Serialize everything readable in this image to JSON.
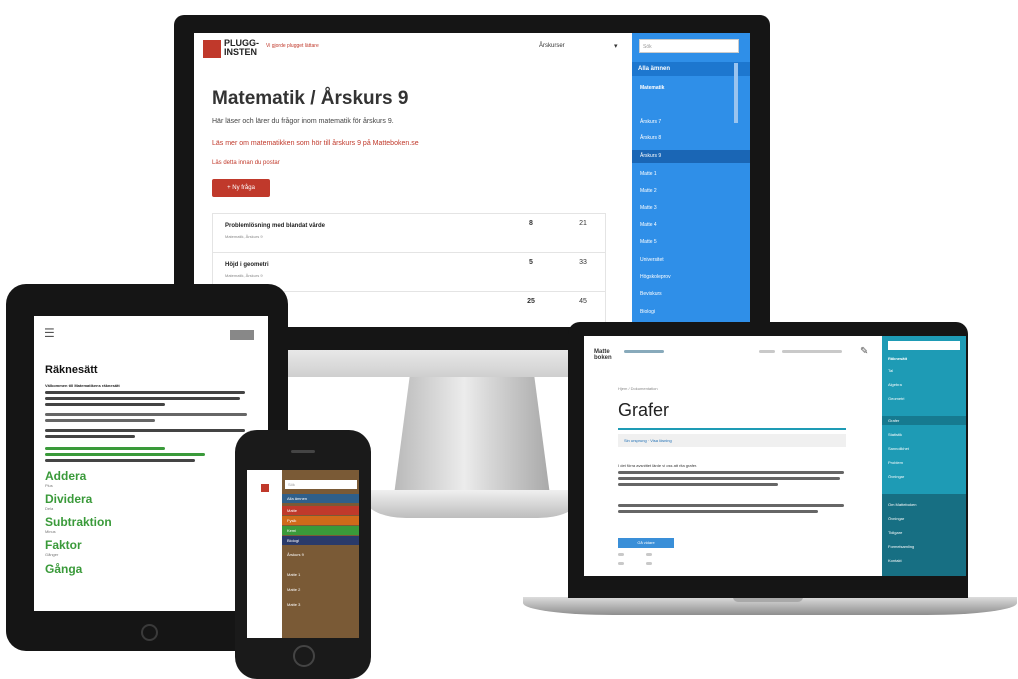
{
  "colors": {
    "brand_red": "#c0392b",
    "sidebar_blue": "#2f8fe8",
    "teal": "#1e9bb5",
    "phone_panel": "#7a5a36",
    "green": "#3a9a3a"
  },
  "monitor": {
    "logo": "PLUGG-INSTEN",
    "tagline": "Vi gjorde plugget lättare",
    "select_label": "Årskurser",
    "search_placeholder": "Sök",
    "title": "Matematik / Årskurs 9",
    "subtitle": "Här läser och lärer du frågor inom matematik för årskurs 9.",
    "link": "Läs mer om matematikken som hör till årskurs 9 på Matteboken.se",
    "toggle_link": "Läs detta innan du postar",
    "new_button": "+ Ny fråga",
    "rows": [
      {
        "title": "Problemlösning med blandat värde",
        "sub": "Matematik, Årskurs 9",
        "n1": "8",
        "n2": "21"
      },
      {
        "title": "Höjd i geometri",
        "sub": "Matematik, Årskurs 9",
        "n1": "5",
        "n2": "33"
      },
      {
        "title": "",
        "sub": "",
        "n1": "25",
        "n2": "45"
      }
    ],
    "sidebar": {
      "all_label": "Alla ämnen",
      "items": [
        "Matematik",
        "Årskurs 7",
        "Årskurs 8",
        "Årskurs 9",
        "Matte 1",
        "Matte 2",
        "Matte 3",
        "Matte 4",
        "Matte 5",
        "Universitet",
        "Högskoleprov",
        "Beviskurs",
        "Biologi"
      ]
    }
  },
  "tablet": {
    "heading": "Räknesätt",
    "para": "Välkommen till Matematikens räknesätt",
    "words": [
      {
        "word": "Addera",
        "sub": "Plus"
      },
      {
        "word": "Dividera",
        "sub": "Dela"
      },
      {
        "word": "Subtraktion",
        "sub": "Minus"
      },
      {
        "word": "Faktor",
        "sub": "Gånger"
      },
      {
        "word": "Gånga",
        "sub": ""
      }
    ]
  },
  "phone": {
    "search_placeholder": "Sök",
    "menu": [
      "Alla ämnen",
      "Matte",
      "Fysik",
      "Kemi",
      "Biologi",
      "Årskurs 9",
      "Matte 1",
      "Matte 2",
      "Matte 3"
    ]
  },
  "laptop": {
    "logo": "Matte boken",
    "crumb": "Hjem / Dokumentation",
    "title": "Grafer",
    "tab_label": "Sin ursprung · Visa lösning",
    "para": "I det förra avsnittet lärde vi oss att rita grafer.",
    "button": "Gå vidare",
    "sidebar": [
      "Räknesätt",
      "Tal",
      "Algebra",
      "Geometri",
      "Grafer",
      "Statistik",
      "Sannolikhet",
      "Problem",
      "Övningar"
    ],
    "sidebar_bottom": [
      "Om Matteboken",
      "Övningar",
      "Tidigare",
      "Formelsamling",
      "Kontakt"
    ]
  }
}
